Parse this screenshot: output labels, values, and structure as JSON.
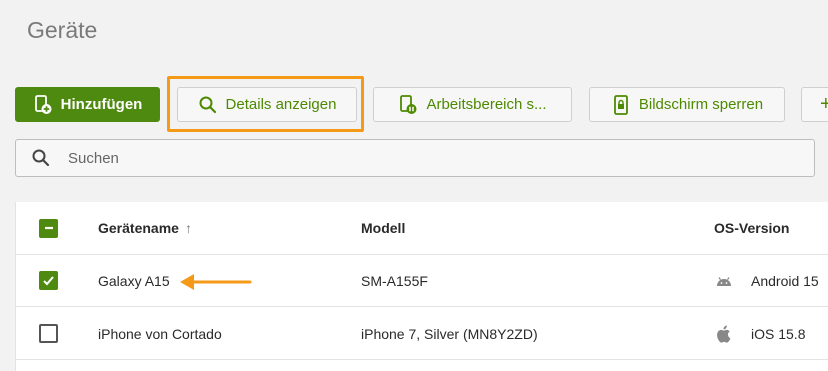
{
  "page": {
    "title": "Geräte"
  },
  "toolbar": {
    "add_label": "Hinzufügen",
    "details_label": "Details anzeigen",
    "workspace_label": "Arbeitsbereich s...",
    "lock_label": "Bildschirm sperren",
    "more_label": "+"
  },
  "search": {
    "placeholder": "Suchen"
  },
  "table": {
    "columns": {
      "name": "Gerätename",
      "sort_indicator": "↑",
      "model": "Modell",
      "os": "OS-Version"
    },
    "rows": [
      {
        "name": "Galaxy A15",
        "model": "SM-A155F",
        "os": "Android 15",
        "os_icon": "android-icon",
        "checked": true
      },
      {
        "name": "iPhone von Cortado",
        "model": "iPhone 7, Silver (MN8Y2ZD)",
        "os": "iOS 15.8",
        "os_icon": "apple-icon",
        "checked": false
      }
    ]
  },
  "colors": {
    "accent": "#4f8a10",
    "highlight": "#f59a18",
    "arrow": "#f59a18"
  }
}
